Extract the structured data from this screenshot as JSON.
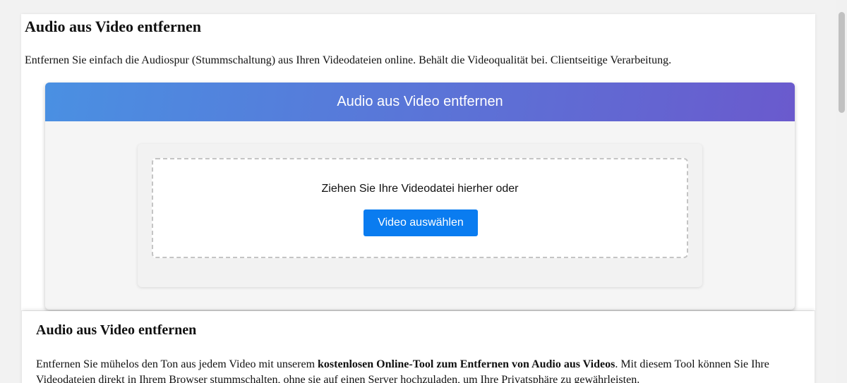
{
  "page": {
    "title": "Audio aus Video entfernen",
    "intro": "Entfernen Sie einfach die Audiospur (Stummschaltung) aus Ihren Videodateien online. Behält die Videoqualität bei. Clientseitige Verarbeitung."
  },
  "tool": {
    "header_title": "Audio aus Video entfernen",
    "drop_text": "Ziehen Sie Ihre Videodatei hierher oder",
    "select_button": "Video auswählen",
    "header_gradient": [
      "#4a90e2",
      "#6a5acd"
    ],
    "button_color": "#0a7cf0"
  },
  "info": {
    "title": "Audio aus Video entfernen",
    "text_part1": "Entfernen Sie mühelos den Ton aus jedem Video mit unserem ",
    "text_bold": "kostenlosen Online-Tool zum Entfernen von Audio aus Videos",
    "text_part2": ". Mit diesem Tool können Sie Ihre Videodateien direkt in Ihrem Browser stummschalten, ohne sie auf einen Server hochzuladen, um Ihre Privatsphäre zu gewährleisten."
  }
}
